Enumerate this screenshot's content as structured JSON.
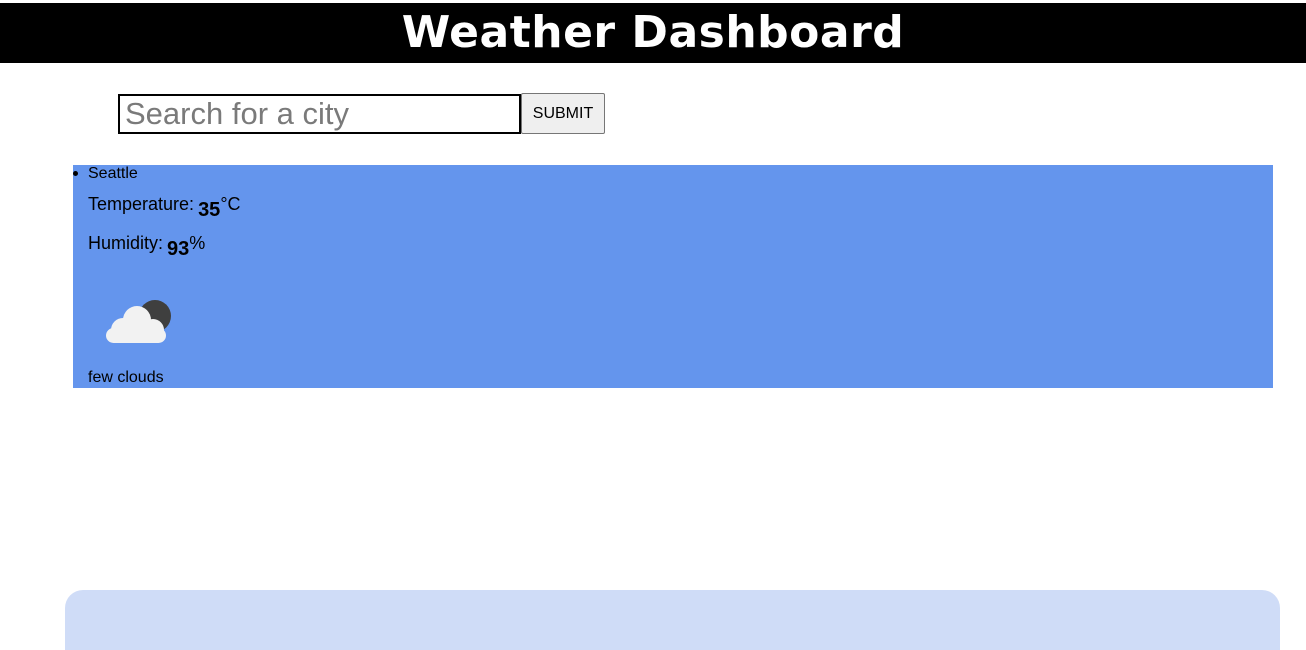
{
  "header": {
    "title": "Weather Dashboard"
  },
  "search": {
    "placeholder": "Search for a city",
    "value": "",
    "submit_label": "SUBMIT"
  },
  "current": {
    "city": "Seattle",
    "temperature_label": "Temperature:",
    "temperature_value": "35",
    "temperature_unit": "°C",
    "humidity_label": "Humidity:",
    "humidity_value": "93",
    "humidity_unit": "%",
    "icon": "few-clouds-night-icon",
    "description": "few clouds"
  },
  "colors": {
    "header_bg": "#000000",
    "results_bg": "#6495ed",
    "forecast_panel_bg": "#cfdcf7"
  }
}
